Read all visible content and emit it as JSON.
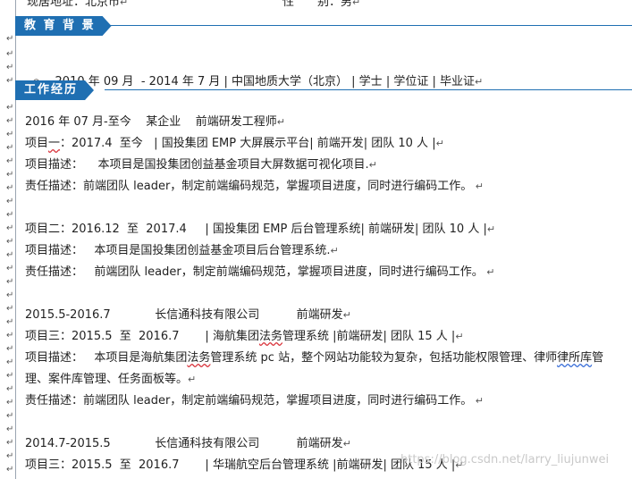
{
  "top": {
    "address": "现居地址：北京市",
    "gender": "性　　别：男"
  },
  "sections": {
    "education": "教 育 背 景",
    "work": "工作经历"
  },
  "education": {
    "bullet": "◎",
    "line": "2010 年 09 月  - 2014 年 7 月 | 中国地质大学（北京） | 学士 | 学位证 | 毕业证"
  },
  "job1": {
    "header": "2016 年 07 月-至今    某企业    前端研发工程师",
    "p1_pre": "项目",
    "p1_wavy": "一",
    "p1_rest": "：2017.4  至今   | 国投集团 EMP 大屏展示平台| 前端开发| 团队 10 人 |",
    "p1_desc": "项目描述：    本项目是国投集团创益基金项目大屏数据可视化项目.",
    "p1_duty": "责任描述：前端团队 leader，制定前端编码规范，掌握项目进度，同时进行编码工作。",
    "p2": "项目二：2016.12  至  2017.4     | 国投集团 EMP 后台管理系统| 前端研发| 团队 10 人 |",
    "p2_desc": "项目描述：   本项目是国投集团创益基金项目后台管理系统.",
    "p2_duty": "责任描述：   前端团队 leader，制定前端编码规范，掌握项目进度，同时进行编码工作。"
  },
  "job2": {
    "header": "2015.5-2016.7            长信通科技有限公司          前端研发",
    "p3_pre": "项目三：2015.5  至  2016.7       | 海航集团",
    "p3_wavy": "法务",
    "p3_rest": "管理系统 |前端研发| 团队 15 人 |",
    "p3_desc1_pre": "项目描述：   本项目是海航集团",
    "p3_desc1_wavy": "法务",
    "p3_desc1_mid": "管理系统 pc 站，整个网站功能较为复杂，包括功能权限管理、律师",
    "p3_desc1_blue": "律所库",
    "p3_desc1_end": "管",
    "p3_desc2": "理、案件库管理、任务面板等。",
    "p3_duty": "责任描述：前端团队 leader，制定前端编码规范，掌握项目进度，同时进行编码工作。"
  },
  "job3": {
    "header": "2014.7-2015.5            长信通科技有限公司          前端研发",
    "p3b": "项目三：2015.5  至  2016.7       | 华瑞航空后台管理系统 |前端研发| 团队 15 人 |"
  },
  "watermark": "https://blog.csdn.net/larry_liujunwei",
  "colors": {
    "accent": "#1f6fb2",
    "spellcheck": "#d9363e"
  }
}
